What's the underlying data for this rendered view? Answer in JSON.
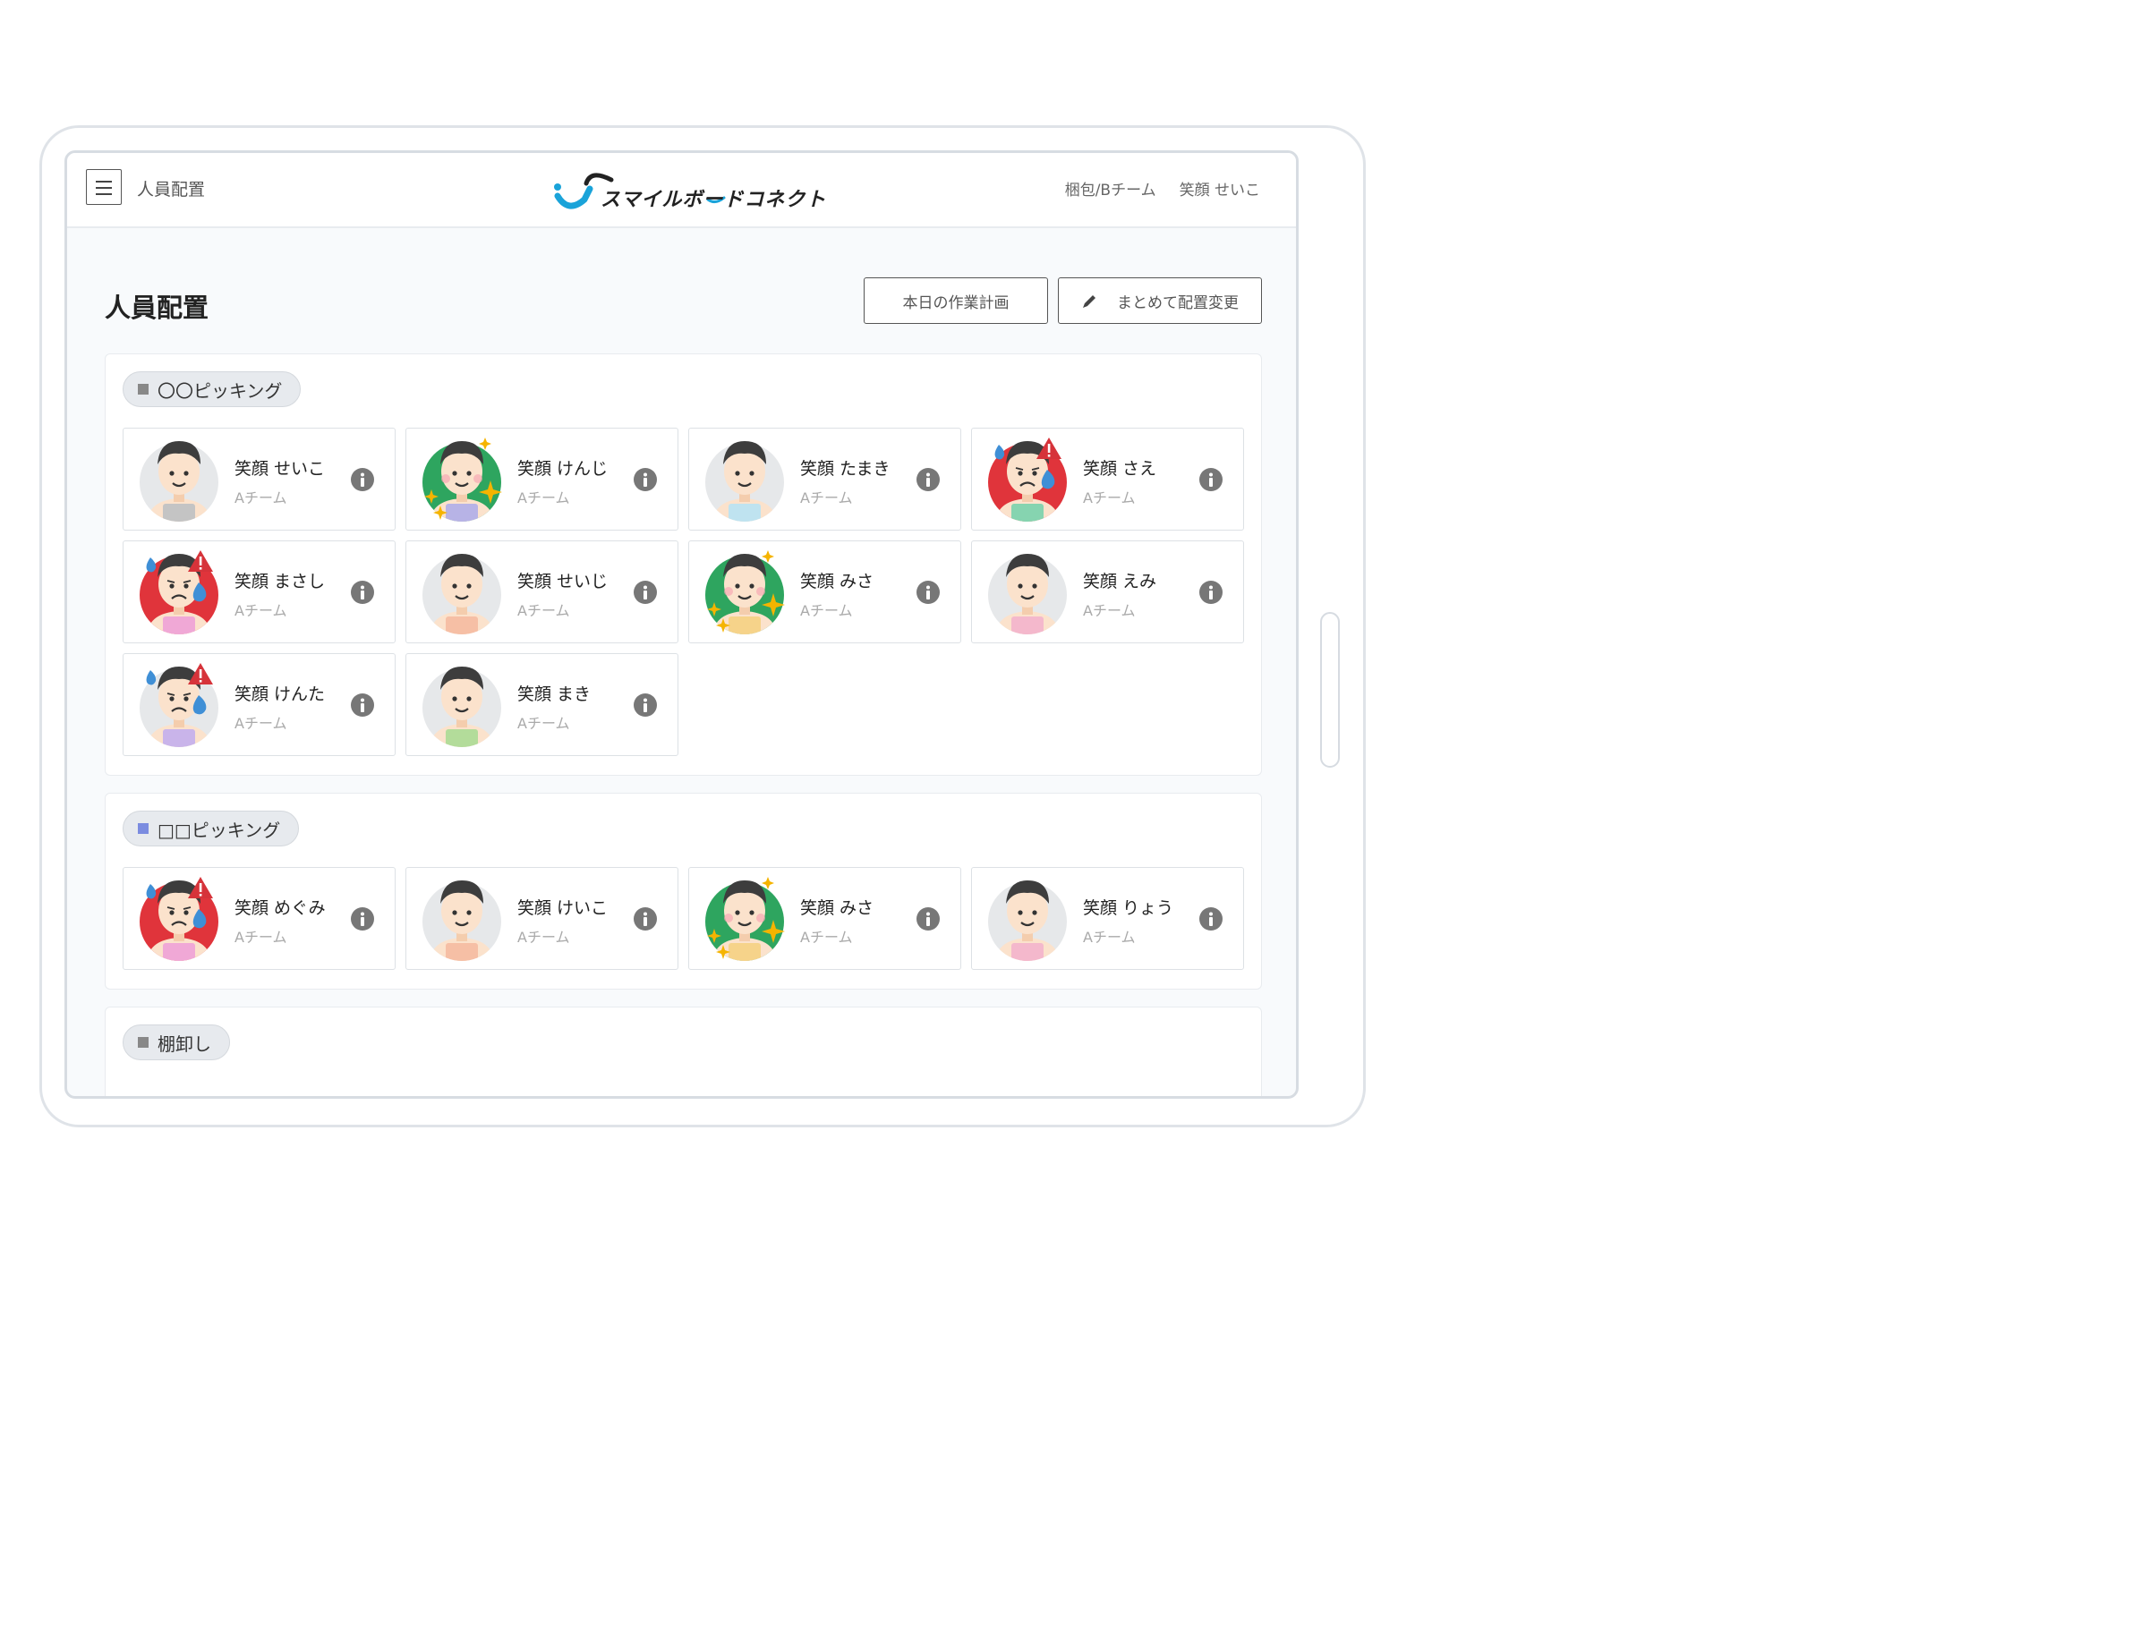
{
  "header": {
    "title": "人員配置",
    "logo_text": "スマイルボードコネクト",
    "team": "梱包/Bチーム",
    "user": "笑顔 せいこ"
  },
  "page": {
    "title": "人員配置",
    "plan_button": "本日の作業計画",
    "bulk_button": "まとめて配置変更"
  },
  "sections": [
    {
      "label": "〇〇ピッキング",
      "color": "#888888",
      "members": [
        {
          "name": "笑顔 せいこ",
          "team": "Aチーム",
          "mood": "normal",
          "shirt": "#c4c4c4"
        },
        {
          "name": "笑顔 けんじ",
          "team": "Aチーム",
          "mood": "happy",
          "shirt": "#b7b3e6"
        },
        {
          "name": "笑顔 たまき",
          "team": "Aチーム",
          "mood": "normal",
          "shirt": "#bfe3f0"
        },
        {
          "name": "笑顔 さえ",
          "team": "Aチーム",
          "mood": "warning",
          "shirt": "#86d4b0"
        },
        {
          "name": "笑顔 まさし",
          "team": "Aチーム",
          "mood": "warning",
          "shirt": "#f0a8d6"
        },
        {
          "name": "笑顔 せいじ",
          "team": "Aチーム",
          "mood": "normal",
          "shirt": "#f6bfa5"
        },
        {
          "name": "笑顔 みさ",
          "team": "Aチーム",
          "mood": "happy",
          "shirt": "#f6d38a"
        },
        {
          "name": "笑顔 えみ",
          "team": "Aチーム",
          "mood": "normal",
          "shirt": "#f4b8cc"
        },
        {
          "name": "笑顔 けんた",
          "team": "Aチーム",
          "mood": "worried",
          "shirt": "#c9b4ea"
        },
        {
          "name": "笑顔 まき",
          "team": "Aチーム",
          "mood": "normal",
          "shirt": "#b3dc9a"
        }
      ]
    },
    {
      "label": "□□ピッキング",
      "color": "#7b8ce0",
      "members": [
        {
          "name": "笑顔 めぐみ",
          "team": "Aチーム",
          "mood": "warning",
          "shirt": "#f0a8d6"
        },
        {
          "name": "笑顔 けいこ",
          "team": "Aチーム",
          "mood": "normal",
          "shirt": "#f6bfa5"
        },
        {
          "name": "笑顔 みさ",
          "team": "Aチーム",
          "mood": "happy",
          "shirt": "#f6d38a"
        },
        {
          "name": "笑顔 りょう",
          "team": "Aチーム",
          "mood": "normal",
          "shirt": "#f4b8cc"
        }
      ]
    },
    {
      "label": "棚卸し",
      "color": "#888888",
      "members": []
    }
  ],
  "colors": {
    "accent": "#1aa3d9",
    "happy_bg": "#2ea55f",
    "warning_bg": "#e0343b",
    "normal_bg": "#e6e8ea"
  },
  "icons": [
    "menu-icon",
    "pencil-icon",
    "info-icon",
    "warning-icon",
    "sparkle-icon",
    "sweat-drop-icon"
  ]
}
